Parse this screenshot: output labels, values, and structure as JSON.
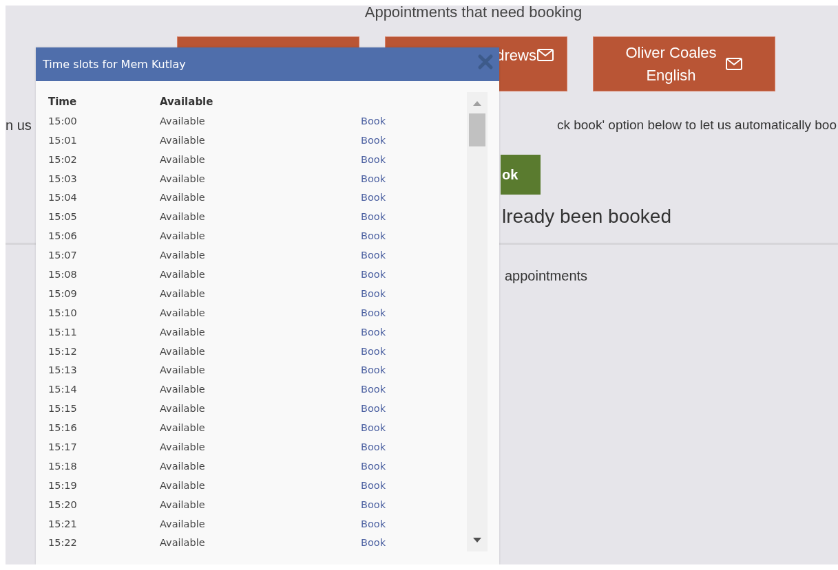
{
  "page": {
    "heading": "Appointments that need booking",
    "teachers": [
      {
        "kind": "covered"
      },
      {
        "kind": "partial",
        "lines": [
          "drews"
        ]
      },
      {
        "kind": "full",
        "lines": [
          "Oliver Coales",
          "English"
        ]
      }
    ],
    "instruction_left": "n us",
    "instruction_right": "ck book' option below to let us automatically boo",
    "quick_book_button": "ok",
    "booked_notice": "lready been booked",
    "appointments_text": "appointments"
  },
  "dialog": {
    "title": "Time slots for Mem Kutlay",
    "columns": [
      "Time",
      "Available"
    ],
    "rows": [
      {
        "time": "15:00",
        "status": "Available",
        "action": "Book"
      },
      {
        "time": "15:01",
        "status": "Available",
        "action": "Book"
      },
      {
        "time": "15:02",
        "status": "Available",
        "action": "Book"
      },
      {
        "time": "15:03",
        "status": "Available",
        "action": "Book"
      },
      {
        "time": "15:04",
        "status": "Available",
        "action": "Book"
      },
      {
        "time": "15:05",
        "status": "Available",
        "action": "Book"
      },
      {
        "time": "15:06",
        "status": "Available",
        "action": "Book"
      },
      {
        "time": "15:07",
        "status": "Available",
        "action": "Book"
      },
      {
        "time": "15:08",
        "status": "Available",
        "action": "Book"
      },
      {
        "time": "15:09",
        "status": "Available",
        "action": "Book"
      },
      {
        "time": "15:10",
        "status": "Available",
        "action": "Book"
      },
      {
        "time": "15:11",
        "status": "Available",
        "action": "Book"
      },
      {
        "time": "15:12",
        "status": "Available",
        "action": "Book"
      },
      {
        "time": "15:13",
        "status": "Available",
        "action": "Book"
      },
      {
        "time": "15:14",
        "status": "Available",
        "action": "Book"
      },
      {
        "time": "15:15",
        "status": "Available",
        "action": "Book"
      },
      {
        "time": "15:16",
        "status": "Available",
        "action": "Book"
      },
      {
        "time": "15:17",
        "status": "Available",
        "action": "Book"
      },
      {
        "time": "15:18",
        "status": "Available",
        "action": "Book"
      },
      {
        "time": "15:19",
        "status": "Available",
        "action": "Book"
      },
      {
        "time": "15:20",
        "status": "Available",
        "action": "Book"
      },
      {
        "time": "15:21",
        "status": "Available",
        "action": "Book"
      },
      {
        "time": "15:22",
        "status": "Available",
        "action": "Book"
      }
    ]
  }
}
